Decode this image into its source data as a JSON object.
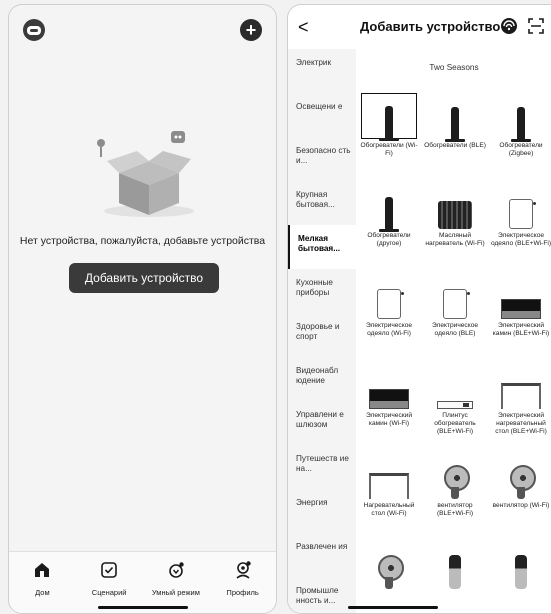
{
  "left": {
    "empty_text": "Нет устройства, пожалуйста, добавьте устройства",
    "add_button": "Добавить устройство",
    "tabs": [
      {
        "label": "Дом",
        "icon": "home-icon"
      },
      {
        "label": "Сценарий",
        "icon": "scenario-icon"
      },
      {
        "label": "Умный режим",
        "icon": "smart-mode-icon"
      },
      {
        "label": "Профиль",
        "icon": "profile-icon"
      }
    ]
  },
  "right": {
    "back_label": "<",
    "title": "Добавить устройство",
    "brand": "Two Seasons",
    "categories": [
      "Электрик",
      "Освещени е",
      "Безопасно сть и...",
      "Крупная бытовая...",
      "Мелкая бытовая...",
      "Кухонные приборы",
      "Здоровье и спорт",
      "Видеонабл юдение",
      "Управлени е шлюзом",
      "Путешеств ие на...",
      "Энергия",
      "Развлечен ия",
      "Промышле нность и..."
    ],
    "active_category_index": 4,
    "devices": [
      {
        "label": "Обогреватели (Wi-Fi)",
        "kind": "heater-tower",
        "selected": true
      },
      {
        "label": "Обогреватели (BLE)",
        "kind": "heater-tower"
      },
      {
        "label": "Обогреватели (Zigbee)",
        "kind": "heater-tower"
      },
      {
        "label": "Обогреватели (другое)",
        "kind": "heater-tower"
      },
      {
        "label": "Масляный нагреватель (Wi-Fi)",
        "kind": "oil-heater"
      },
      {
        "label": "Электрическое одеяло (BLE+Wi-Fi)",
        "kind": "blanket"
      },
      {
        "label": "Электрическое одеяло (Wi-Fi)",
        "kind": "blanket"
      },
      {
        "label": "Электрическое одеяло (BLE)",
        "kind": "blanket"
      },
      {
        "label": "Электрический камин (BLE+Wi-Fi)",
        "kind": "fireplace"
      },
      {
        "label": "Электрический камин (Wi-Fi)",
        "kind": "fireplace"
      },
      {
        "label": "Плинтус обогреватель (BLE+Wi-Fi)",
        "kind": "plinth"
      },
      {
        "label": "Электрический нагревательный стол (BLE+Wi-Fi)",
        "kind": "table-heater"
      },
      {
        "label": "Нагревательный стол (Wi-Fi)",
        "kind": "table-heater"
      },
      {
        "label": "вентилятор (BLE+Wi-Fi)",
        "kind": "fan"
      },
      {
        "label": "вентилятор (Wi-Fi)",
        "kind": "fan"
      },
      {
        "label": "",
        "kind": "fan"
      },
      {
        "label": "",
        "kind": "tower-fan"
      },
      {
        "label": "",
        "kind": "tower-fan"
      }
    ]
  }
}
